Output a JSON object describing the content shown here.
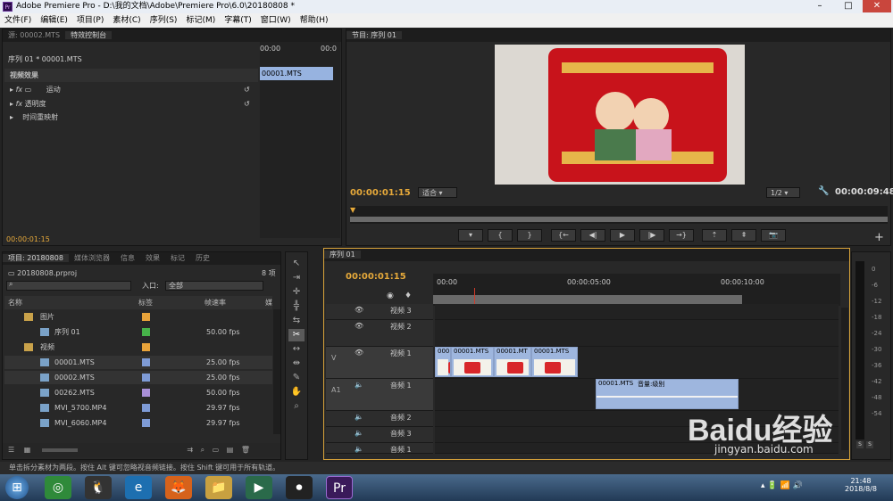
{
  "window": {
    "title": "Adobe Premiere Pro - D:\\我的文档\\Adobe\\Premiere Pro\\6.0\\20180808 *",
    "app_icon": "Pr"
  },
  "menu": [
    "文件(F)",
    "编辑(E)",
    "项目(P)",
    "素材(C)",
    "序列(S)",
    "标记(M)",
    "字幕(T)",
    "窗口(W)",
    "帮助(H)"
  ],
  "source_panel": {
    "tabs": [
      "源: 00002.MTS",
      "特效控制台"
    ],
    "sequence_label": "序列 01 * 00001.MTS",
    "ruler_start": "00:00",
    "ruler_end": "00:0",
    "clip_label": "00001.MTS",
    "section": "视频效果",
    "effects": [
      "运动",
      "透明度",
      "时间重映射"
    ],
    "timecode": "00:00:01:15"
  },
  "program": {
    "tab": "节目: 序列 01",
    "timecode_current": "00:00:01:15",
    "fit_label": "适合",
    "quality": "1/2",
    "timecode_total": "00:00:09:48",
    "controls": [
      "marker",
      "in",
      "out",
      "go-in",
      "step-back",
      "play",
      "step-fwd",
      "go-out",
      "lift",
      "extract",
      "export-frame"
    ],
    "add_label": "+"
  },
  "project": {
    "tabs": [
      "项目: 20180808",
      "媒体浏览器",
      "信息",
      "效果",
      "标记",
      "历史"
    ],
    "file": "20180808.prproj",
    "count": "8 项",
    "search_placeholder": "",
    "in_label": "入口:",
    "in_value": "全部",
    "columns": [
      "名称",
      "标签",
      "帧速率",
      "媒"
    ],
    "items": [
      {
        "name": "图片",
        "label_color": "#e8a33a",
        "fps": "",
        "type": "folder",
        "indent": 0
      },
      {
        "name": "序列 01",
        "label_color": "#47b34a",
        "fps": "50.00 fps",
        "type": "sequence",
        "indent": 1
      },
      {
        "name": "视频",
        "label_color": "#e8a33a",
        "fps": "",
        "type": "folder",
        "indent": 0
      },
      {
        "name": "00001.MTS",
        "label_color": "#7e9bd6",
        "fps": "25.00 fps",
        "type": "clip",
        "indent": 1
      },
      {
        "name": "00002.MTS",
        "label_color": "#7e9bd6",
        "fps": "25.00 fps",
        "type": "clip",
        "indent": 1
      },
      {
        "name": "00262.MTS",
        "label_color": "#a98fd8",
        "fps": "50.00 fps",
        "type": "clip",
        "indent": 1
      },
      {
        "name": "MVI_5700.MP4",
        "label_color": "#7e9bd6",
        "fps": "29.97 fps",
        "type": "clip",
        "indent": 1
      },
      {
        "name": "MVI_6060.MP4",
        "label_color": "#7e9bd6",
        "fps": "29.97 fps",
        "type": "clip",
        "indent": 1
      }
    ]
  },
  "timeline": {
    "tab": "序列 01",
    "timecode": "00:00:01:15",
    "ruler": [
      "00:00",
      "00:00:05:00",
      "00:00:10:00"
    ],
    "tracks": [
      {
        "name": "视频 3",
        "kind": "v"
      },
      {
        "name": "视频 2",
        "kind": "v"
      },
      {
        "name": "视频 1",
        "kind": "v",
        "target": "V"
      },
      {
        "name": "音频 1",
        "kind": "a",
        "target": "A1"
      },
      {
        "name": "音频 2",
        "kind": "a"
      },
      {
        "name": "音频 3",
        "kind": "a"
      },
      {
        "name": "音频 1",
        "kind": "a"
      }
    ],
    "video_clips": [
      "000",
      "00001.MTS",
      "00001.MT",
      "00001.MTS"
    ],
    "audio_clip": {
      "name": "00001.MTS",
      "label": "音量:级别"
    }
  },
  "meter": {
    "labels": [
      "0",
      "-6",
      "-12",
      "-18",
      "-24",
      "-30",
      "-36",
      "-42",
      "-48",
      "-54"
    ],
    "buttons": [
      "S",
      "S"
    ]
  },
  "status": "单击拆分素材为两段。按住 Alt 键可忽略视音频链接。按住 Shift 键可用于所有轨道。",
  "taskbar": {
    "time": "21:48",
    "date": "2018/8/8",
    "apps": [
      "start",
      "360",
      "qq",
      "ie",
      "firefox",
      "explorer",
      "media",
      "record",
      "premiere"
    ]
  },
  "watermark": {
    "brand": "Baidu经验",
    "url": "jingyan.baidu.com"
  }
}
